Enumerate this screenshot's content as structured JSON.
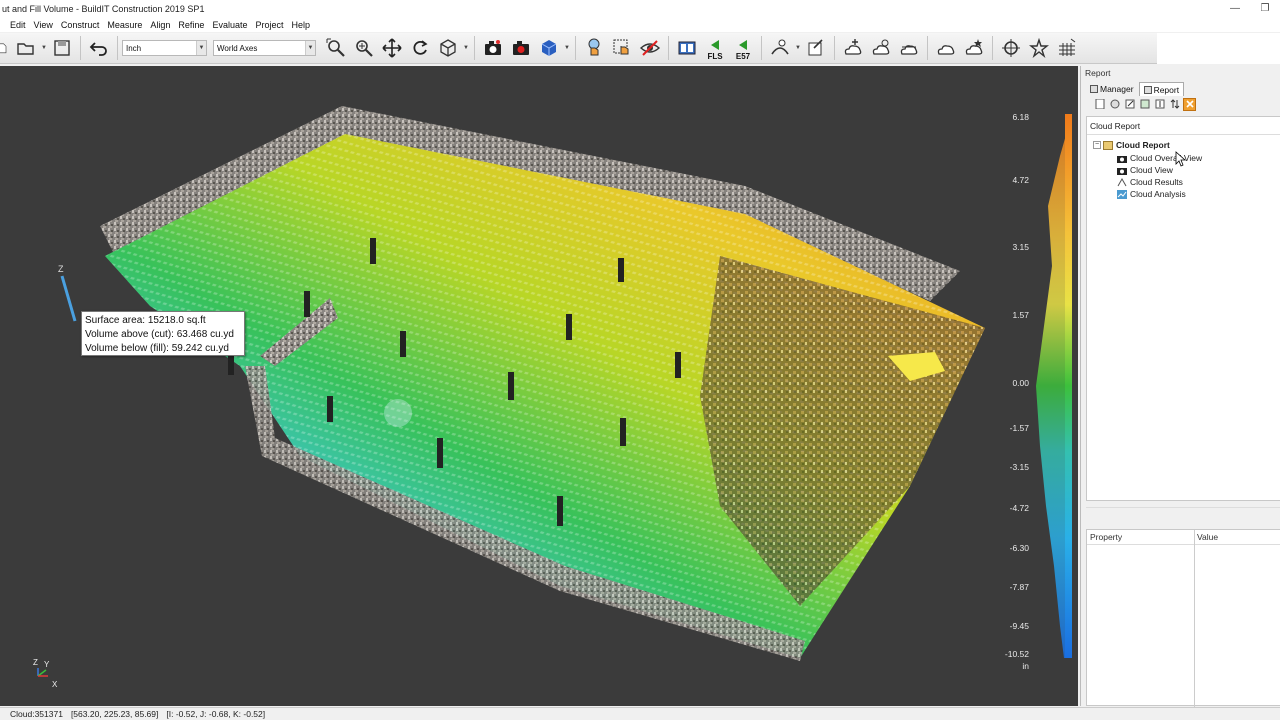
{
  "window": {
    "title": "ut and Fill Volume - BuildIT Construction 2019 SP1",
    "minimize": "—",
    "restore": "❐"
  },
  "menu": [
    "Edit",
    "View",
    "Construct",
    "Measure",
    "Align",
    "Refine",
    "Evaluate",
    "Project",
    "Help"
  ],
  "toolbar": {
    "units_value": "Inch",
    "axes_value": "World Axes",
    "fls_label": "FLS",
    "e57_label": "E57"
  },
  "viewport": {
    "legend_labels": [
      "6.18",
      "4.72",
      "3.15",
      "1.57",
      "0.00",
      "-1.57",
      "-3.15",
      "-4.72",
      "-6.30",
      "-7.87",
      "-9.45",
      "-10.52"
    ],
    "legend_unit": "in",
    "z_axis_label": "Z",
    "mini_axes": {
      "z": "Z",
      "y": "Y",
      "x": "X"
    },
    "tooltip": {
      "surface_area": "Surface area: 15218.0 sq.ft",
      "volume_cut": "Volume above (cut): 63.468 cu.yd",
      "volume_fill": "Volume below (fill): 59.242 cu.yd"
    },
    "colors": {
      "background": "#3b3b3b",
      "high": "#f07a1a",
      "zero": "#3cc03c",
      "low": "#1a6ee0"
    }
  },
  "panel": {
    "header": "Report",
    "tabs": [
      {
        "label": "Manager"
      },
      {
        "label": "Report"
      }
    ],
    "tree_title": "Cloud Report",
    "tree": {
      "root": "Cloud Report",
      "children": [
        "Cloud Overall View",
        "Cloud View",
        "Cloud Results",
        "Cloud Analysis"
      ]
    },
    "props_header": {
      "property": "Property",
      "value": "Value"
    }
  },
  "status": {
    "cloud": "Cloud:351371",
    "coords": "[563.20, 225.23, 85.69]",
    "normal": "[I: -0.52, J: -0.68, K: -0.52]"
  }
}
